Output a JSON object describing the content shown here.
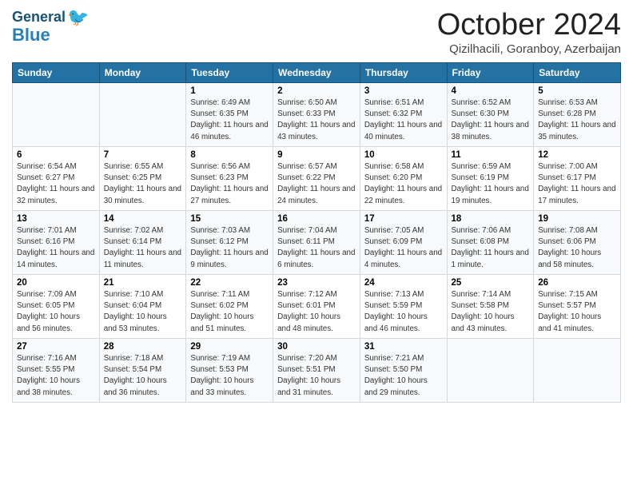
{
  "header": {
    "logo_general": "General",
    "logo_blue": "Blue",
    "month_title": "October 2024",
    "location": "Qizilhacili, Goranboy, Azerbaijan"
  },
  "weekdays": [
    "Sunday",
    "Monday",
    "Tuesday",
    "Wednesday",
    "Thursday",
    "Friday",
    "Saturday"
  ],
  "weeks": [
    [
      {
        "day": "",
        "info": ""
      },
      {
        "day": "",
        "info": ""
      },
      {
        "day": "1",
        "info": "Sunrise: 6:49 AM\nSunset: 6:35 PM\nDaylight: 11 hours and 46 minutes."
      },
      {
        "day": "2",
        "info": "Sunrise: 6:50 AM\nSunset: 6:33 PM\nDaylight: 11 hours and 43 minutes."
      },
      {
        "day": "3",
        "info": "Sunrise: 6:51 AM\nSunset: 6:32 PM\nDaylight: 11 hours and 40 minutes."
      },
      {
        "day": "4",
        "info": "Sunrise: 6:52 AM\nSunset: 6:30 PM\nDaylight: 11 hours and 38 minutes."
      },
      {
        "day": "5",
        "info": "Sunrise: 6:53 AM\nSunset: 6:28 PM\nDaylight: 11 hours and 35 minutes."
      }
    ],
    [
      {
        "day": "6",
        "info": "Sunrise: 6:54 AM\nSunset: 6:27 PM\nDaylight: 11 hours and 32 minutes."
      },
      {
        "day": "7",
        "info": "Sunrise: 6:55 AM\nSunset: 6:25 PM\nDaylight: 11 hours and 30 minutes."
      },
      {
        "day": "8",
        "info": "Sunrise: 6:56 AM\nSunset: 6:23 PM\nDaylight: 11 hours and 27 minutes."
      },
      {
        "day": "9",
        "info": "Sunrise: 6:57 AM\nSunset: 6:22 PM\nDaylight: 11 hours and 24 minutes."
      },
      {
        "day": "10",
        "info": "Sunrise: 6:58 AM\nSunset: 6:20 PM\nDaylight: 11 hours and 22 minutes."
      },
      {
        "day": "11",
        "info": "Sunrise: 6:59 AM\nSunset: 6:19 PM\nDaylight: 11 hours and 19 minutes."
      },
      {
        "day": "12",
        "info": "Sunrise: 7:00 AM\nSunset: 6:17 PM\nDaylight: 11 hours and 17 minutes."
      }
    ],
    [
      {
        "day": "13",
        "info": "Sunrise: 7:01 AM\nSunset: 6:16 PM\nDaylight: 11 hours and 14 minutes."
      },
      {
        "day": "14",
        "info": "Sunrise: 7:02 AM\nSunset: 6:14 PM\nDaylight: 11 hours and 11 minutes."
      },
      {
        "day": "15",
        "info": "Sunrise: 7:03 AM\nSunset: 6:12 PM\nDaylight: 11 hours and 9 minutes."
      },
      {
        "day": "16",
        "info": "Sunrise: 7:04 AM\nSunset: 6:11 PM\nDaylight: 11 hours and 6 minutes."
      },
      {
        "day": "17",
        "info": "Sunrise: 7:05 AM\nSunset: 6:09 PM\nDaylight: 11 hours and 4 minutes."
      },
      {
        "day": "18",
        "info": "Sunrise: 7:06 AM\nSunset: 6:08 PM\nDaylight: 11 hours and 1 minute."
      },
      {
        "day": "19",
        "info": "Sunrise: 7:08 AM\nSunset: 6:06 PM\nDaylight: 10 hours and 58 minutes."
      }
    ],
    [
      {
        "day": "20",
        "info": "Sunrise: 7:09 AM\nSunset: 6:05 PM\nDaylight: 10 hours and 56 minutes."
      },
      {
        "day": "21",
        "info": "Sunrise: 7:10 AM\nSunset: 6:04 PM\nDaylight: 10 hours and 53 minutes."
      },
      {
        "day": "22",
        "info": "Sunrise: 7:11 AM\nSunset: 6:02 PM\nDaylight: 10 hours and 51 minutes."
      },
      {
        "day": "23",
        "info": "Sunrise: 7:12 AM\nSunset: 6:01 PM\nDaylight: 10 hours and 48 minutes."
      },
      {
        "day": "24",
        "info": "Sunrise: 7:13 AM\nSunset: 5:59 PM\nDaylight: 10 hours and 46 minutes."
      },
      {
        "day": "25",
        "info": "Sunrise: 7:14 AM\nSunset: 5:58 PM\nDaylight: 10 hours and 43 minutes."
      },
      {
        "day": "26",
        "info": "Sunrise: 7:15 AM\nSunset: 5:57 PM\nDaylight: 10 hours and 41 minutes."
      }
    ],
    [
      {
        "day": "27",
        "info": "Sunrise: 7:16 AM\nSunset: 5:55 PM\nDaylight: 10 hours and 38 minutes."
      },
      {
        "day": "28",
        "info": "Sunrise: 7:18 AM\nSunset: 5:54 PM\nDaylight: 10 hours and 36 minutes."
      },
      {
        "day": "29",
        "info": "Sunrise: 7:19 AM\nSunset: 5:53 PM\nDaylight: 10 hours and 33 minutes."
      },
      {
        "day": "30",
        "info": "Sunrise: 7:20 AM\nSunset: 5:51 PM\nDaylight: 10 hours and 31 minutes."
      },
      {
        "day": "31",
        "info": "Sunrise: 7:21 AM\nSunset: 5:50 PM\nDaylight: 10 hours and 29 minutes."
      },
      {
        "day": "",
        "info": ""
      },
      {
        "day": "",
        "info": ""
      }
    ]
  ]
}
